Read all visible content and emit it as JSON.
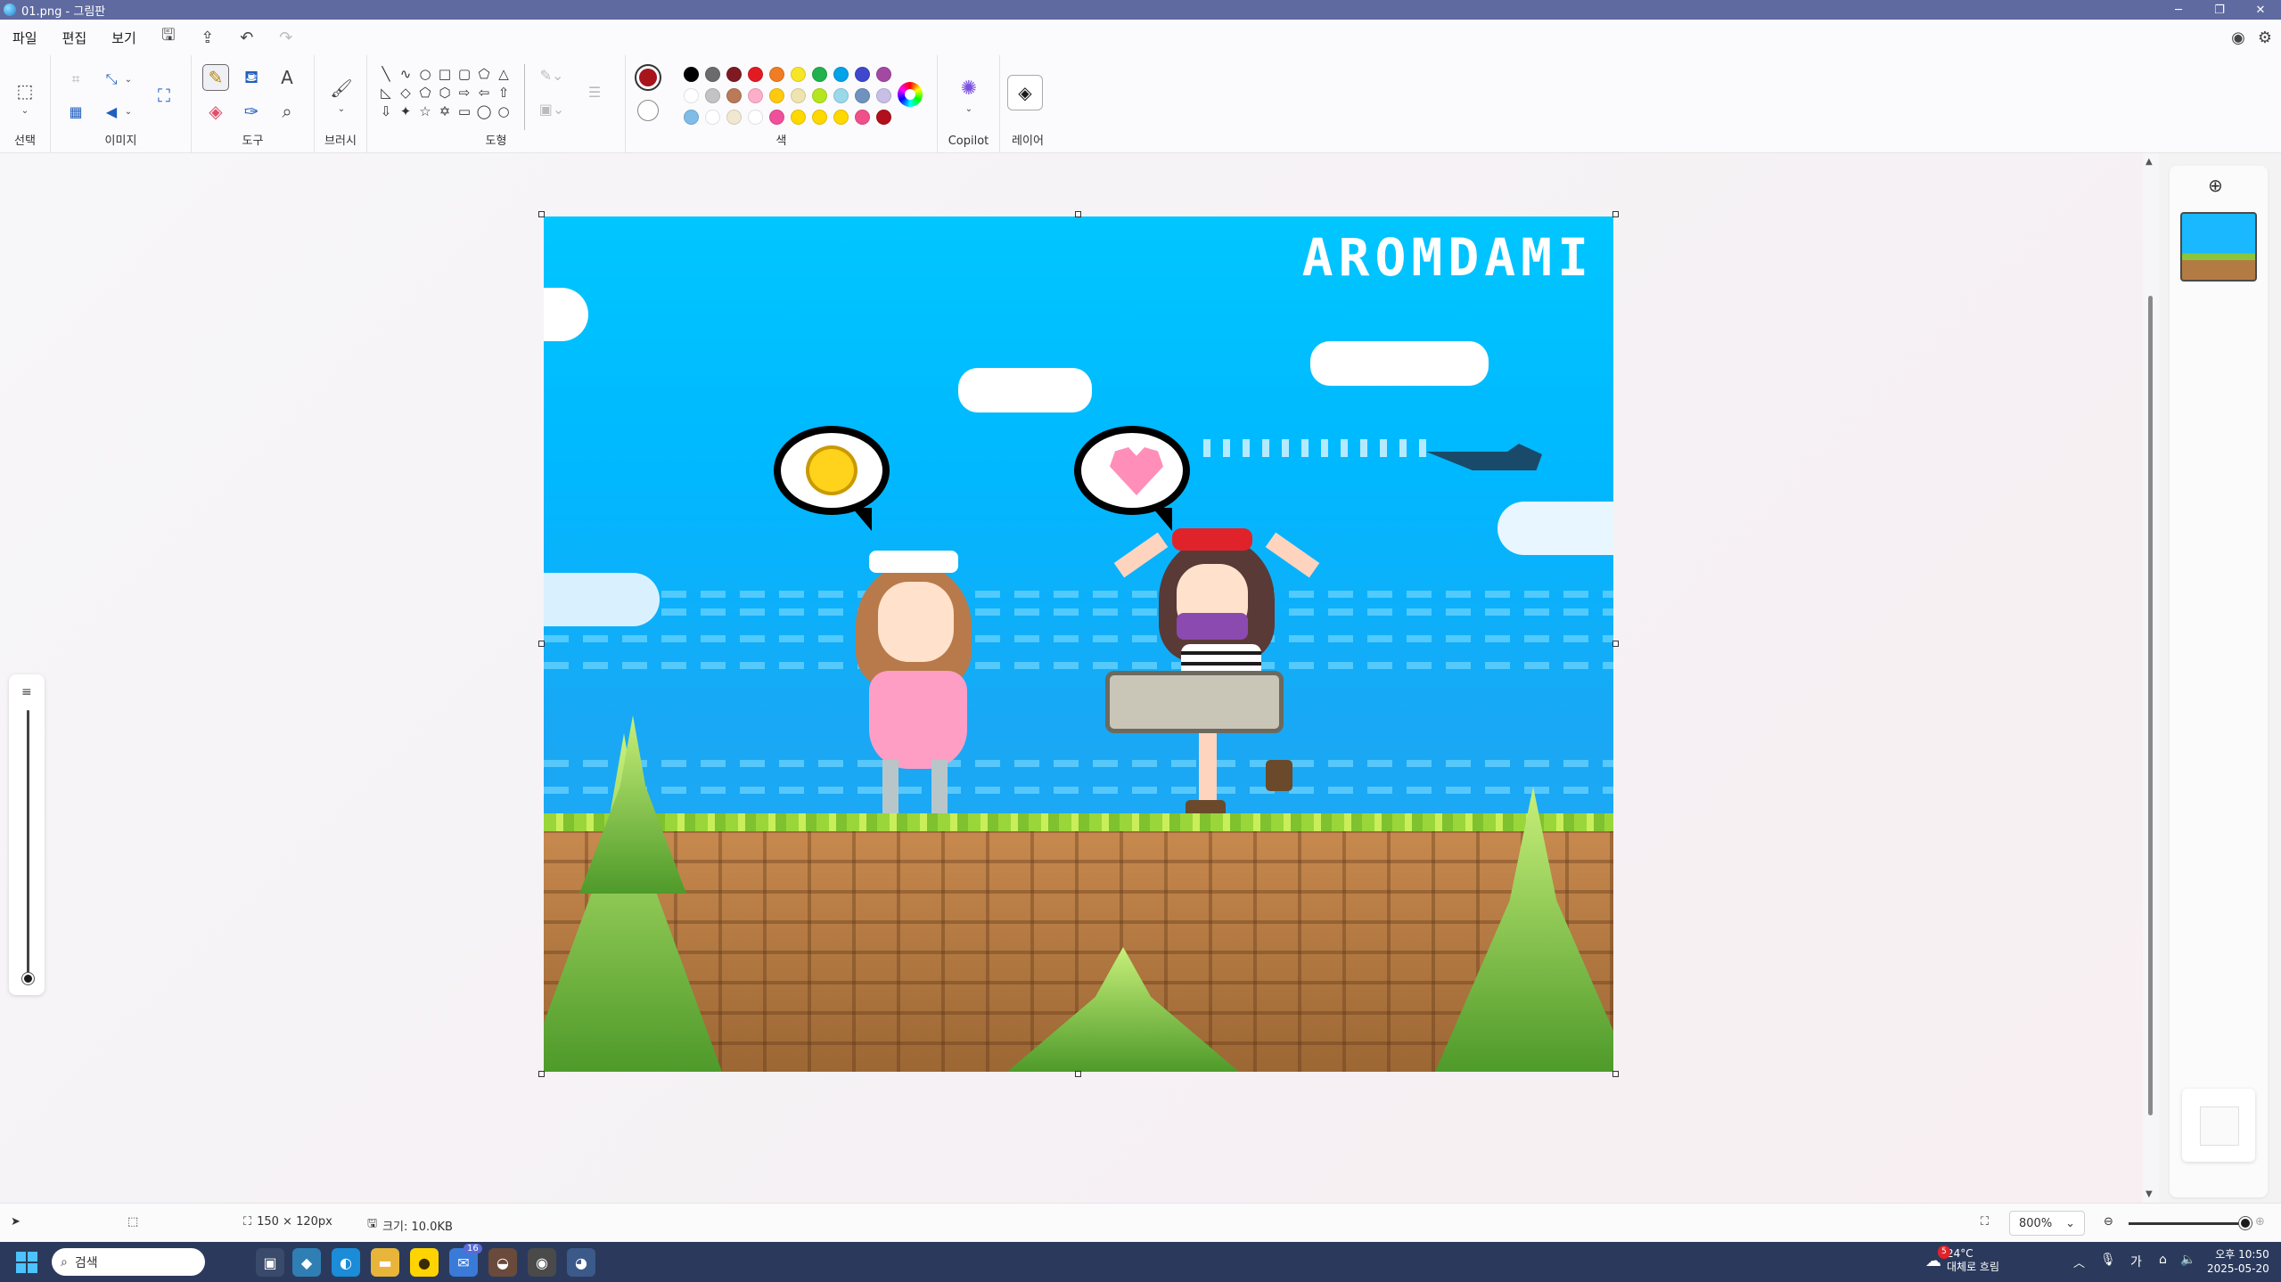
{
  "window": {
    "title": "01.png - 그림판",
    "controls": {
      "minimize": "─",
      "restore": "❐",
      "close": "✕"
    }
  },
  "menu": {
    "file": "파일",
    "edit": "편집",
    "view": "보기"
  },
  "ribbon": {
    "groups": {
      "select": "선택",
      "image": "이미지",
      "tools": "도구",
      "brushes": "브러시",
      "shapes": "도형",
      "colors": "색",
      "copilot": "Copilot",
      "layers": "레이어"
    },
    "primary_color": "#a8141c",
    "secondary_color": "#ffffff",
    "palette": [
      "#000000",
      "#6b6b6b",
      "#7f1a22",
      "#e21b23",
      "#f07d24",
      "#f7e626",
      "#22b14c",
      "#00a2e8",
      "#3f48cc",
      "#a349a4",
      "#ffffff",
      "#c3c3c3",
      "#b97a57",
      "#ffaec9",
      "#ffc90e",
      "#efe4b0",
      "#b5e61d",
      "#99d9ea",
      "#7092be",
      "#c8bfe7",
      "#7fbce8",
      "#ffffff",
      "#f0e8d0",
      "#ffffff",
      "#f0509a",
      "#ffd800",
      "#ffd800",
      "#ffd800",
      "#f0508a",
      "#b0101c"
    ]
  },
  "canvas": {
    "logo_text": "AROMDAMI"
  },
  "status": {
    "dimensions": "150 × 120px",
    "file_size": "크기: 10.0KB",
    "zoom": "800%"
  },
  "taskbar": {
    "search_label": "검색",
    "badge_count": "16",
    "weather_temp": "24°C",
    "weather_desc": "대체로 흐림",
    "weather_alert": "5",
    "time": "오후 10:50",
    "date": "2025-05-20",
    "ime": "가"
  }
}
